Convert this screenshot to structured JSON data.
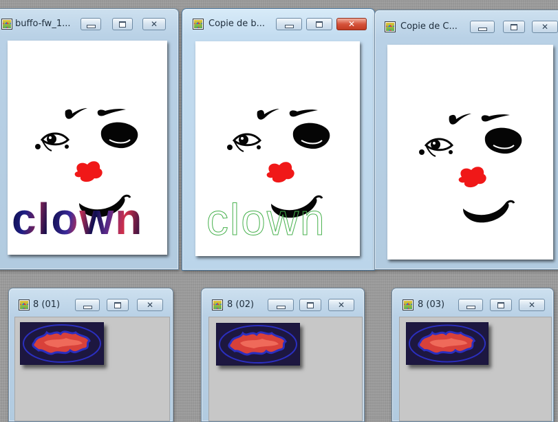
{
  "windows": {
    "w1": {
      "title": "buffo-fw_1...",
      "caption": "clown"
    },
    "w2": {
      "title": "Copie de b...",
      "caption": "clown"
    },
    "w3": {
      "title": "Copie de C..."
    },
    "t1": {
      "title": "8 (01)"
    },
    "t2": {
      "title": "8 (02)"
    },
    "t3": {
      "title": "8 (03)"
    }
  },
  "close_glyph": "✕",
  "colors": {
    "nose": "#f01818",
    "ink": "#050505",
    "outline_text": "#47b14d",
    "thumb_blob": "#d8413a",
    "thumb_edge": "#2b2fbf"
  },
  "icons": [
    "image-app-icon",
    "minimize-icon",
    "maximize-icon",
    "close-icon"
  ]
}
